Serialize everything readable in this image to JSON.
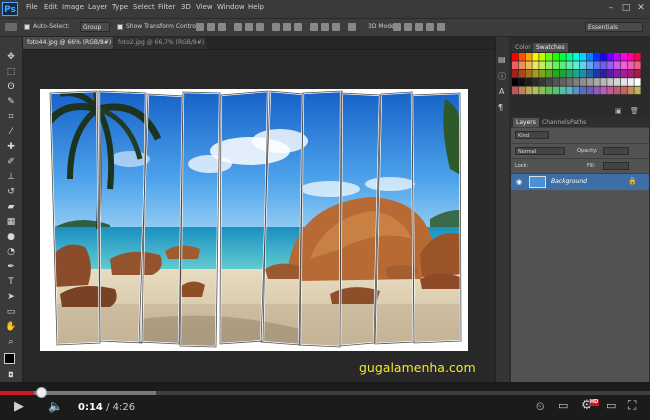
{
  "menubar": {
    "logo": "Ps",
    "items": [
      "File",
      "Edit",
      "Image",
      "Layer",
      "Type",
      "Select",
      "Filter",
      "3D",
      "View",
      "Window",
      "Help"
    ]
  },
  "options": {
    "auto_select": "Auto-Select:",
    "group": "Group",
    "show_transform": "Show Transform Controls",
    "mode_3d": "3D Mode:",
    "workspace": "Essentials"
  },
  "tabs": [
    {
      "label": "foto44.jpg @ 66% (RGB/8#)",
      "active": true
    },
    {
      "label": "foto2.jpg @ 66,7% (RGB/8#)",
      "active": false
    }
  ],
  "panels": {
    "top_tabs": [
      "Color",
      "Swatches"
    ],
    "layer_tabs": [
      "Layers",
      "Channels",
      "Paths"
    ],
    "kind": "Kind",
    "blend": "Normal",
    "opacity_label": "Opacity:",
    "lock_label": "Lock:",
    "fill_label": "Fill:",
    "layer_name": "Background"
  },
  "watermark": "gugalamenha.com",
  "video": {
    "current": "0:14",
    "total": "4:26",
    "separator": "/",
    "progress_fraction": 0.053,
    "hd": "HD"
  },
  "colors": {
    "accent_red": "#cc181e",
    "ps_blue": "#4fa3ff",
    "watermark": "#f5e830",
    "selected_layer": "#3d6fa6"
  }
}
